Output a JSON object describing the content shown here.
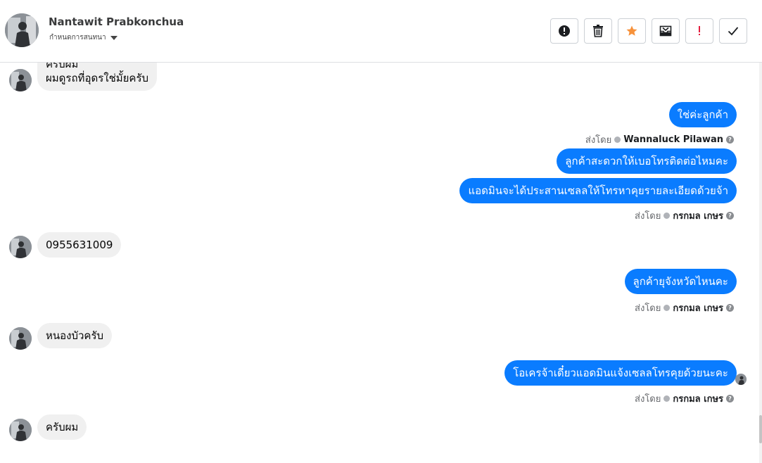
{
  "header": {
    "name": "Nantawit Prabkonchua",
    "subtitle": "กำหนดการสนทนา",
    "actions": [
      {
        "icon": "alert-circle-icon"
      },
      {
        "icon": "trash-icon"
      },
      {
        "icon": "star-icon",
        "color": "#f7923b"
      },
      {
        "icon": "move-inbox-icon"
      },
      {
        "icon": "exclamation-icon",
        "color": "#e41e3f"
      },
      {
        "icon": "check-icon"
      }
    ]
  },
  "messages": {
    "m1": {
      "line1": "ครับผม",
      "line2": "ผมดูรถที่อุดรใช่มั้ยครับ"
    },
    "m2": {
      "text": "ใช่ค่ะลูกค้า"
    },
    "s1": {
      "prefix": "ส่งโดย",
      "name": "Wannaluck Pilawan"
    },
    "m3": {
      "text": "ลูกค้าสะดวกให้เบอโทรติดต่อไหมคะ"
    },
    "m4": {
      "text": "แอดมินจะได้ประสานเซลลให้โทรหาคุยรายละเอียดด้วยจ้า"
    },
    "s2": {
      "prefix": "ส่งโดย",
      "name": "กรกมล เกษร"
    },
    "m5": {
      "text": "0955631009"
    },
    "m6": {
      "text": "ลูกค้ายุจังหวัดไหนคะ"
    },
    "s3": {
      "prefix": "ส่งโดย",
      "name": "กรกมล เกษร"
    },
    "m7": {
      "text": "หนองบัวครับ"
    },
    "m8": {
      "text": "โอเครจ้าเดี๋ยวแอดมินแจ้งเซลลโทรคุยด้วยนะคะ"
    },
    "s4": {
      "prefix": "ส่งโดย",
      "name": "กรกมล เกษร"
    },
    "m9": {
      "text": "ครับผม"
    }
  },
  "colors": {
    "outgoing": "#0a7cff",
    "incoming": "#f0f0f0"
  }
}
